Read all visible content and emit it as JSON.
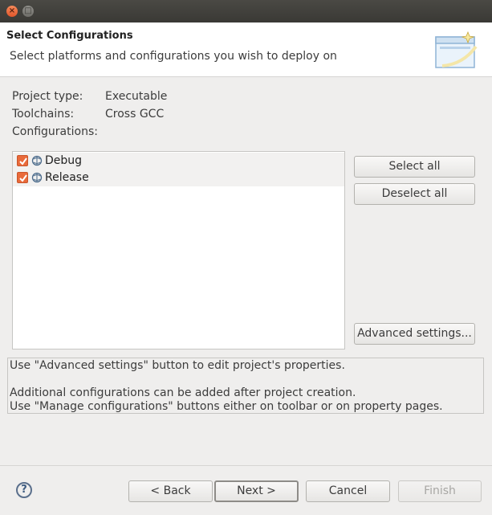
{
  "window": {
    "close_glyph": "×",
    "maximize_glyph": "□"
  },
  "header": {
    "title": "Select Configurations",
    "description": "Select platforms and configurations you wish to deploy on"
  },
  "project_info": {
    "project_type_label": "Project type:",
    "project_type_value": "Executable",
    "toolchains_label": "Toolchains:",
    "toolchains_value": "Cross GCC",
    "configurations_label": "Configurations:"
  },
  "configurations": [
    {
      "label": "Debug",
      "checked": true,
      "icon": "configuration-icon"
    },
    {
      "label": "Release",
      "checked": true,
      "icon": "configuration-icon"
    }
  ],
  "side_buttons": {
    "select_all": "Select all",
    "deselect_all": "Deselect all",
    "advanced_settings": "Advanced settings..."
  },
  "messages": {
    "line1": "Use \"Advanced settings\" button to edit project's properties.",
    "line2": "Additional configurations can be added after project creation.",
    "line3": "Use \"Manage configurations\" buttons either on toolbar or on property pages."
  },
  "footer": {
    "help_glyph": "?",
    "back": "< Back",
    "next": "Next >",
    "cancel": "Cancel",
    "finish": "Finish"
  },
  "colors": {
    "checkbox": "#e96a3a",
    "close_button": "#e2562b",
    "titlebar": "#3a3935"
  }
}
